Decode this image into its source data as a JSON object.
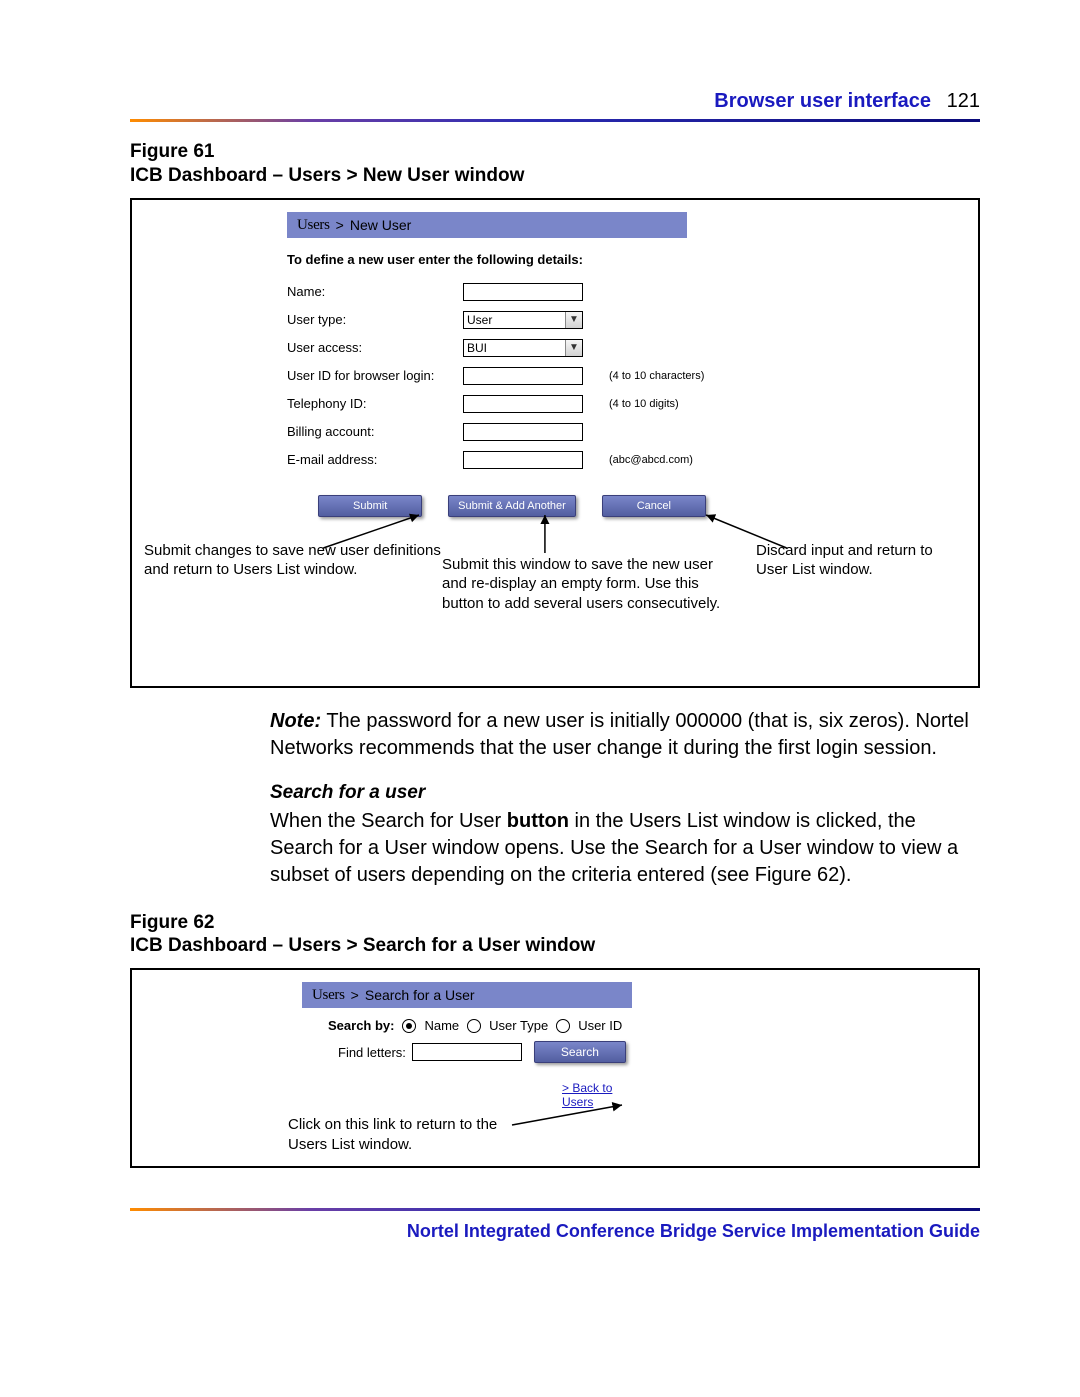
{
  "header": {
    "section": "Browser user interface",
    "page": "121"
  },
  "fig1": {
    "label": "Figure 61",
    "title": "ICB Dashboard – Users > New User window",
    "crumb_brand": "Users",
    "crumb_rest": "New User",
    "intro": "To define a new user enter the following details:",
    "fields": {
      "name": "Name:",
      "type": "User type:",
      "type_val": "User",
      "access": "User access:",
      "access_val": "BUI",
      "userid": "User ID for browser login:",
      "userid_hint": "(4 to 10 characters)",
      "tel": "Telephony ID:",
      "tel_hint": "(4 to 10 digits)",
      "bill": "Billing account:",
      "email": "E-mail address:",
      "email_hint": "(abc@abcd.com)"
    },
    "buttons": {
      "submit": "Submit",
      "submit_add": "Submit & Add Another",
      "cancel": "Cancel"
    },
    "ann_left": "Submit changes to save new user definitions and return to Users List window.",
    "ann_mid": "Submit this window to save the new user and re-display an empty form. Use this button to add several users consecutively.",
    "ann_right": "Discard input and return to User List window."
  },
  "note": {
    "label": "Note:",
    "text": "The password for a new user is initially 000000 (that is, six zeros). Nortel Networks recommends that the user change it during the first login session."
  },
  "search_section": {
    "heading": "Search for a user",
    "para_a": "When the Search for User ",
    "para_bold": "button",
    "para_b": " in the Users List window is clicked, the Search for a User window opens. Use the Search for a User window to view a subset of users depending on the criteria entered (see Figure 62)."
  },
  "fig2": {
    "label": "Figure 62",
    "title": "ICB Dashboard – Users > Search for a User window",
    "crumb_brand": "Users",
    "crumb_rest": "Search for a User",
    "search_by": "Search by:",
    "opt_name": "Name",
    "opt_type": "User Type",
    "opt_id": "User ID",
    "find": "Find letters:",
    "search_btn": "Search",
    "back": "> Back to Users",
    "ann": "Click on this link to return to the Users List window."
  },
  "footer": "Nortel Integrated Conference Bridge Service Implementation Guide"
}
